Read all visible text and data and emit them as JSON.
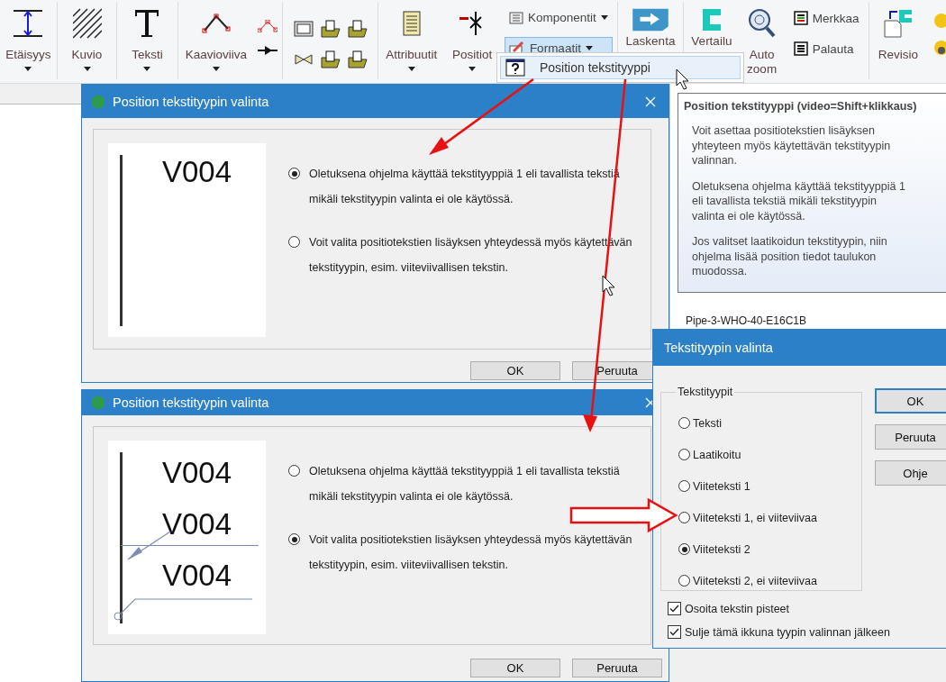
{
  "ribbon": {
    "groups": [
      {
        "items": [
          {
            "kind": "large",
            "label": "Etäisyys",
            "dropdown": true
          }
        ]
      },
      {
        "items": [
          {
            "kind": "large",
            "label": "Kuvio",
            "dropdown": true
          }
        ]
      },
      {
        "items": [
          {
            "kind": "large",
            "label": "Teksti",
            "dropdown": true
          }
        ]
      },
      {
        "items": [
          {
            "kind": "large",
            "label": "Kaavioviiva",
            "dropdown": true
          },
          {
            "kind": "icons"
          }
        ]
      },
      {
        "items": [
          {
            "kind": "icons"
          }
        ]
      },
      {
        "items": [
          {
            "kind": "large",
            "label": "Attribuutit",
            "dropdown": true
          },
          {
            "kind": "large",
            "label": "Positiot",
            "dropdown": true
          },
          {
            "kind": "stack",
            "items": [
              {
                "label": "Komponentit",
                "dropdown": true,
                "selected": false
              },
              {
                "label": "Formaatit",
                "dropdown": true,
                "selected": true
              }
            ]
          }
        ]
      },
      {
        "items": [
          {
            "kind": "large",
            "label": "Laskenta"
          }
        ]
      },
      {
        "items": [
          {
            "kind": "large",
            "label": "Vertailu"
          },
          {
            "kind": "large",
            "label": "Auto zoom"
          },
          {
            "kind": "stack",
            "items": [
              {
                "label": "Merkkaa",
                "selected": false
              },
              {
                "label": "Palauta",
                "selected": false
              }
            ]
          }
        ]
      },
      {
        "items": [
          {
            "kind": "large",
            "label": "Revisio"
          },
          {
            "kind": "icons"
          }
        ]
      }
    ]
  },
  "menu": {
    "items": [
      {
        "label": "Position tekstityyppi",
        "selected": true
      }
    ]
  },
  "list": {
    "items": [
      "Pipe-3-WHO-40-E16C1B"
    ]
  },
  "tooltip": {
    "title": "Position tekstityyppi (video=Shift+klikkaus)",
    "paragraphs": [
      "Voit asettaa positiotekstien lisäyksen yhteyteen myös käytettävän tekstityypin valinnan.",
      "Oletuksena ohjelma käyttää tekstityyppiä 1 eli tavallista tekstiä mikäli tekstityypin valinta ei ole käytössä.",
      "Jos valitset laatikoidun tekstityypin, niin ohjelma lisää position tiedot taulukon muodossa."
    ]
  },
  "dialogs": [
    {
      "title": "Position tekstityypin valinta",
      "preview": {
        "kind": "plain",
        "labels": [
          "V004"
        ]
      },
      "options": [
        {
          "label": "Oletuksena ohjelma käyttää tekstityyppiä 1 eli tavallista tekstiä mikäli tekstityypin valinta ei ole käytössä.",
          "selected": true
        },
        {
          "label": "Voit valita positiotekstien lisäyksen yhteydessä myös käytettävän tekstityypin, esim. viiteviivallisen tekstin.",
          "selected": false
        }
      ],
      "buttons": [
        "OK",
        "Peruuta"
      ]
    },
    {
      "title": "Position tekstityypin valinta",
      "preview": {
        "kind": "leader",
        "labels": [
          "V004",
          "V004",
          "V004"
        ]
      },
      "options": [
        {
          "label": "Oletuksena ohjelma käyttää tekstityyppiä 1 eli tavallista tekstiä mikäli tekstityypin valinta ei ole käytössä.",
          "selected": false
        },
        {
          "label": "Voit valita positiotekstien lisäyksen yhteydessä myös käytettävän tekstityypin, esim. viiteviivallisen tekstin.",
          "selected": true
        }
      ],
      "buttons": [
        "OK",
        "Peruuta"
      ]
    }
  ],
  "type_dialog": {
    "title": "Tekstityypin valinta",
    "group_label": "Tekstityypit",
    "options": [
      {
        "label": "Teksti",
        "selected": false
      },
      {
        "label": "Laatikoitu",
        "selected": false
      },
      {
        "label": "Viiteteksti 1",
        "selected": false
      },
      {
        "label": "Viiteteksti 1, ei viiteviivaa",
        "selected": false
      },
      {
        "label": "Viiteteksti 2",
        "selected": true
      },
      {
        "label": "Viiteteksti 2, ei viiteviivaa",
        "selected": false
      }
    ],
    "buttons": [
      {
        "label": "OK",
        "default": true
      },
      {
        "label": "Peruuta",
        "default": false
      },
      {
        "label": "Ohje",
        "default": false
      }
    ],
    "checkboxes": [
      {
        "label": "Osoita tekstin pisteet",
        "checked": true
      },
      {
        "label": "Sulje tämä ikkuna tyypin valinnan jälkeen",
        "checked": true
      }
    ]
  }
}
